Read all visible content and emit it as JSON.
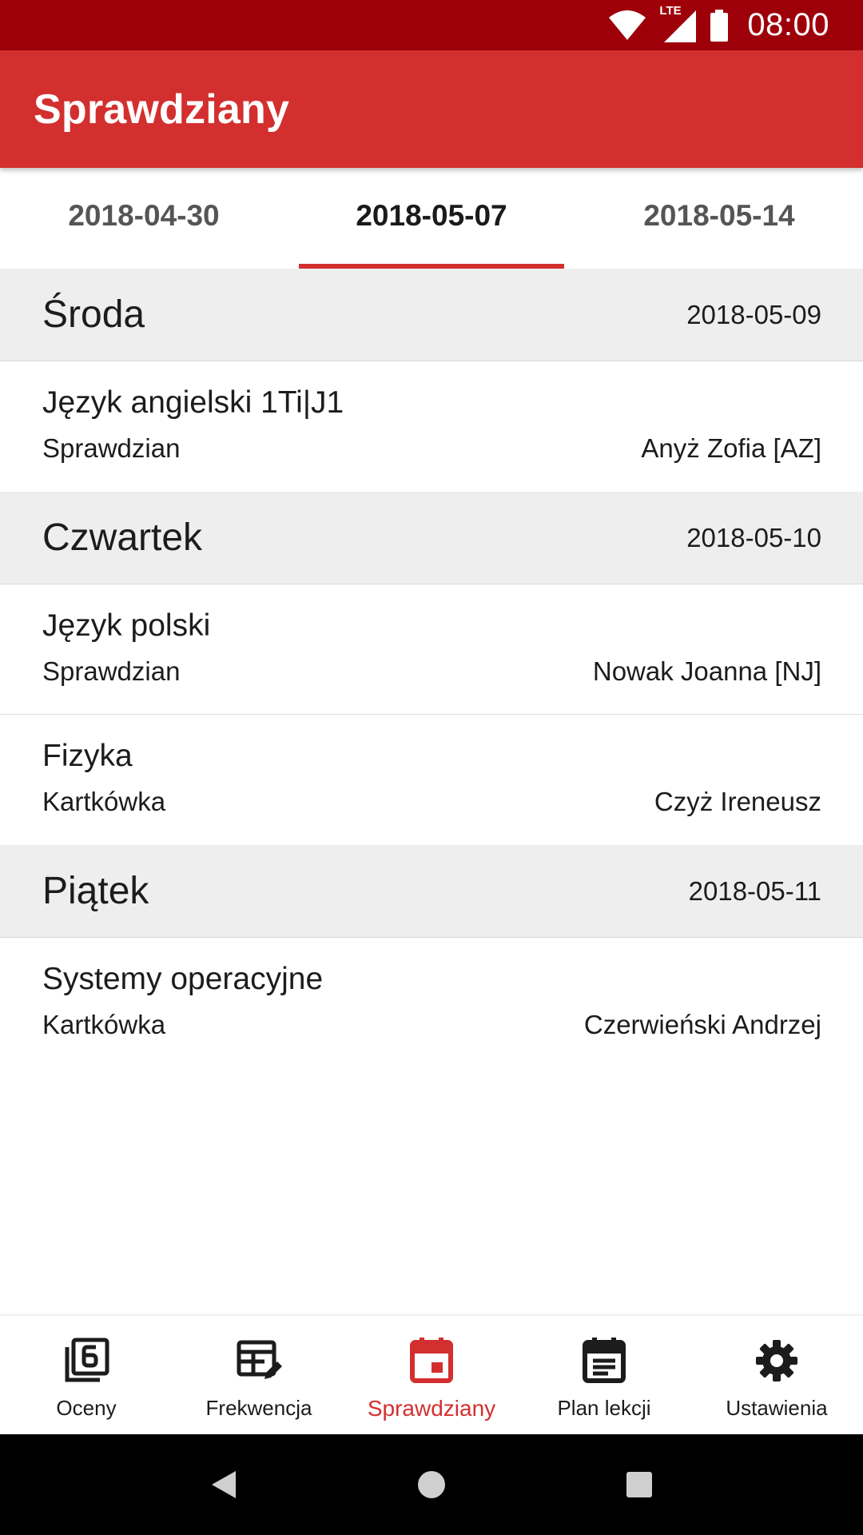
{
  "status_bar": {
    "time": "08:00",
    "network": "LTE"
  },
  "app_bar": {
    "title": "Sprawdziany"
  },
  "tabs": [
    {
      "label": "2018-04-30",
      "active": false
    },
    {
      "label": "2018-05-07",
      "active": true
    },
    {
      "label": "2018-05-14",
      "active": false
    }
  ],
  "days": [
    {
      "name": "Środa",
      "date": "2018-05-09",
      "entries": [
        {
          "subject": "Język angielski 1Ti|J1",
          "type": "Sprawdzian",
          "teacher": "Anyż Zofia [AZ]"
        }
      ]
    },
    {
      "name": "Czwartek",
      "date": "2018-05-10",
      "entries": [
        {
          "subject": "Język polski",
          "type": "Sprawdzian",
          "teacher": "Nowak Joanna [NJ]"
        },
        {
          "subject": "Fizyka",
          "type": "Kartkówka",
          "teacher": "Czyż Ireneusz"
        }
      ]
    },
    {
      "name": "Piątek",
      "date": "2018-05-11",
      "entries": [
        {
          "subject": "Systemy operacyjne",
          "type": "Kartkówka",
          "teacher": "Czerwieński Andrzej"
        }
      ]
    }
  ],
  "bottom_nav": [
    {
      "label": "Oceny",
      "icon": "grades-icon",
      "active": false
    },
    {
      "label": "Frekwencja",
      "icon": "attendance-icon",
      "active": false
    },
    {
      "label": "Sprawdziany",
      "icon": "calendar-event-icon",
      "active": true
    },
    {
      "label": "Plan lekcji",
      "icon": "timetable-icon",
      "active": false
    },
    {
      "label": "Ustawienia",
      "icon": "gear-icon",
      "active": false
    }
  ],
  "colors": {
    "primary": "#d32f2f",
    "status_bar": "#9e000a",
    "header_bg": "#eeeeee",
    "inactive_icon": "#1c1c1c"
  }
}
